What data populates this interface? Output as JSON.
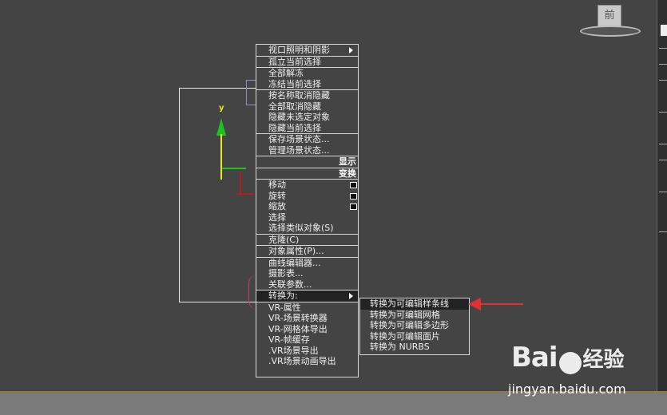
{
  "viewport": {
    "view_cube_label": "前",
    "axis_label": "y"
  },
  "context_menu": {
    "groups": [
      {
        "items": [
          {
            "label": "视口照明和阴影",
            "has_submenu": true
          }
        ]
      },
      {
        "items": [
          {
            "label": "孤立当前选择"
          }
        ]
      },
      {
        "items": [
          {
            "label": "全部解冻"
          },
          {
            "label": "冻结当前选择"
          }
        ]
      },
      {
        "items": [
          {
            "label": "按名称取消隐藏"
          },
          {
            "label": "全部取消隐藏"
          },
          {
            "label": "隐藏未选定对象"
          },
          {
            "label": "隐藏当前选择"
          }
        ]
      },
      {
        "items": [
          {
            "label": "保存场景状态..."
          },
          {
            "label": "管理场景状态..."
          }
        ]
      }
    ],
    "header_display": "显示",
    "header_transform": "变换",
    "transform_items": [
      {
        "label": "移动",
        "has_options": true
      },
      {
        "label": "旋转",
        "has_options": true
      },
      {
        "label": "缩放",
        "has_options": true
      },
      {
        "label": "选择"
      },
      {
        "label": "选择类似对象(S)"
      }
    ],
    "clone": "克隆(C)",
    "object_properties": "对象属性(P)...",
    "editors": [
      {
        "label": "曲线编辑器..."
      },
      {
        "label": "摄影表..."
      },
      {
        "label": "关联参数..."
      }
    ],
    "convert_to": "转换为:",
    "vray_items": [
      {
        "label": "VR-属性"
      },
      {
        "label": "VR-场景转换器"
      },
      {
        "label": "VR-网格体导出"
      },
      {
        "label": "VR-帧缓存"
      },
      {
        "label": ".VR场景导出"
      },
      {
        "label": ".VR场景动画导出"
      }
    ]
  },
  "submenu": {
    "items": [
      {
        "label": "转换为可编辑样条线",
        "highlighted": true
      },
      {
        "label": "转换为可编辑网格"
      },
      {
        "label": "转换为可编辑多边形"
      },
      {
        "label": "转换为可编辑面片"
      },
      {
        "label": "转换为 NURBS"
      }
    ]
  },
  "watermark": {
    "logo": "Bai",
    "logo_suffix": "经验",
    "url": "jingyan.baidu.com"
  },
  "colors": {
    "viewport_bg": "#444444",
    "menu_border": "#d8d8d8",
    "annotation_arrow": "#e03030"
  }
}
